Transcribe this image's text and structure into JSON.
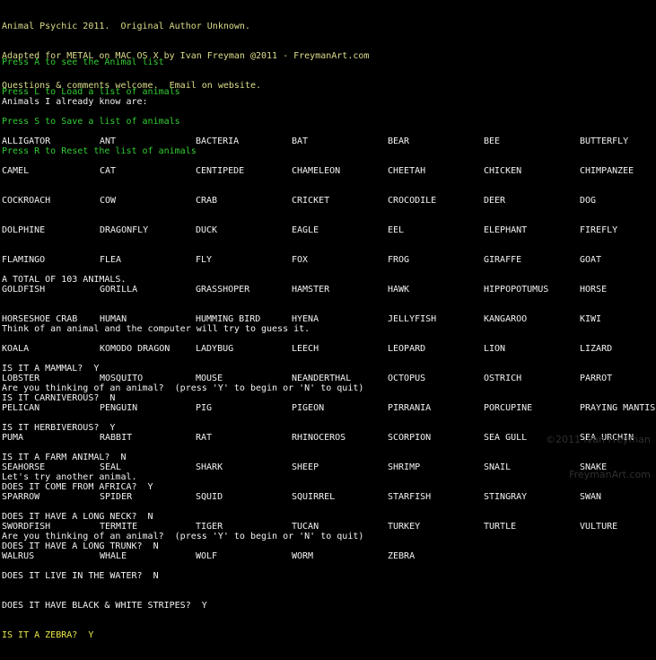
{
  "app": {
    "title": "Animal Psychic 2011",
    "background_color": "#000000",
    "header_color": "#dcdc8c",
    "menu_color": "#33cc33",
    "body_color": "#f2f2f2",
    "accent_color": "#e8e84a",
    "watermark_color": "#2f2f2f"
  },
  "header": {
    "line1": "Animal Psychic 2011.  Original Author Unknown.",
    "line2": "Adapted for METAL on MAC OS X by Ivan Freyman @2011 - FreymanArt.com",
    "line3": "Questions & comments welcome.  Email on website."
  },
  "menu": {
    "items": [
      "Press A to see the Animal list",
      "Press L to Load a list of animals",
      "Press S to Save a list of animals",
      "Press R to Reset the list of animals"
    ]
  },
  "known": {
    "heading": "Animals I already know are:",
    "total": "A TOTAL OF 103 ANIMALS.",
    "columns": [
      [
        "ALLIGATOR",
        "CAMEL",
        "COCKROACH",
        "DOLPHINE",
        "FLAMINGO",
        "GOLDFISH",
        "HORSESHOE CRAB",
        "KOALA",
        "LOBSTER",
        "PELICAN",
        "PUMA",
        "SEAHORSE",
        "SPARROW",
        "SWORDFISH",
        "WALRUS"
      ],
      [
        "ANT",
        "CAT",
        "COW",
        "DRAGONFLY",
        "FLEA",
        "GORILLA",
        "HUMAN",
        "KOMODO DRAGON",
        "MOSQUITO",
        "PENGUIN",
        "RABBIT",
        "SEAL",
        "SPIDER",
        "TERMITE",
        "WHALE"
      ],
      [
        "BACTERIA",
        "CENTIPEDE",
        "CRAB",
        "DUCK",
        "FLY",
        "GRASSHOPER",
        "HUMMING BIRD",
        "LADYBUG",
        "MOUSE",
        "PIG",
        "RAT",
        "SHARK",
        "SQUID",
        "TIGER",
        "WOLF"
      ],
      [
        "BAT",
        "CHAMELEON",
        "CRICKET",
        "EAGLE",
        "FOX",
        "HAMSTER",
        "HYENA",
        "LEECH",
        "NEANDERTHAL",
        "PIGEON",
        "RHINOCEROS",
        "SHEEP",
        "SQUIRREL",
        "TUCAN",
        "WORM"
      ],
      [
        "BEAR",
        "CHEETAH",
        "CROCODILE",
        "EEL",
        "FROG",
        "HAWK",
        "JELLYFISH",
        "LEOPARD",
        "OCTOPUS",
        "PIRRANIA",
        "SCORPION",
        "SHRIMP",
        "STARFISH",
        "TURKEY",
        "ZEBRA"
      ],
      [
        "BEE",
        "CHICKEN",
        "DEER",
        "ELEPHANT",
        "GIRAFFE",
        "HIPPOPOTUMUS",
        "KANGAROO",
        "LION",
        "OSTRICH",
        "PORCUPINE",
        "SEA GULL",
        "SNAIL",
        "STINGRAY",
        "TURTLE",
        ""
      ],
      [
        "BUTTERFLY",
        "CHIMPANZEE",
        "DOG",
        "FIREFLY",
        "GOAT",
        "HORSE",
        "KIWI",
        "LIZARD",
        "PARROT",
        "PRAYING MANTIS",
        "SEA URCHIN",
        "SNAKE",
        "SWAN",
        "VULTURE",
        ""
      ]
    ]
  },
  "intro": {
    "line1": "Think of an animal and the computer will try to guess it.",
    "line2": "Are you thinking of an animal?  (press 'Y' to begin or 'N' to quit)"
  },
  "qa": {
    "entries": [
      {
        "text": "IS IT A MAMMAL?  Y",
        "highlight": false
      },
      {
        "text": "IS IT CARNIVEROUS?  N",
        "highlight": false
      },
      {
        "text": "IS IT HERBIVEROUS?  Y",
        "highlight": false
      },
      {
        "text": "IS IT A FARM ANIMAL?  N",
        "highlight": false
      },
      {
        "text": "DOES IT COME FROM AFRICA?  Y",
        "highlight": false
      },
      {
        "text": "DOES IT HAVE A LONG NECK?  N",
        "highlight": false
      },
      {
        "text": "DOES IT HAVE A LONG TRUNK?  N",
        "highlight": false
      },
      {
        "text": "DOES IT LIVE IN THE WATER?  N",
        "highlight": false
      },
      {
        "text": "DOES IT HAVE BLACK & WHITE STRIPES?  Y",
        "highlight": false
      },
      {
        "text": "IS IT A ZEBRA?  Y",
        "highlight": true
      }
    ]
  },
  "footer": {
    "line1": "Let's try another animal.",
    "line2": "Are you thinking of an animal?  (press 'Y' to begin or 'N' to quit)"
  },
  "watermark": {
    "line1": "©2011 Ivan Freyman",
    "line2": "FreymanArt.com"
  }
}
